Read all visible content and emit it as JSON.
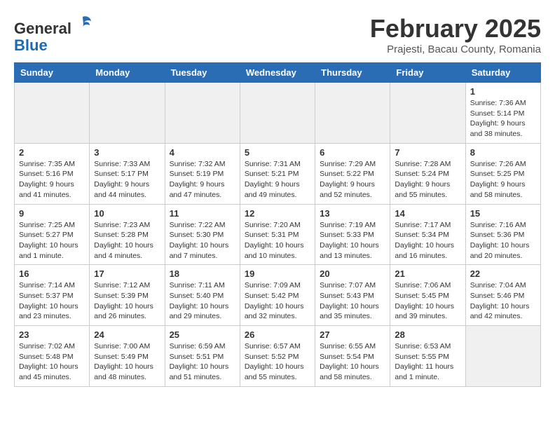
{
  "header": {
    "logo_line1": "General",
    "logo_line2": "Blue",
    "month": "February 2025",
    "location": "Prajesti, Bacau County, Romania"
  },
  "columns": [
    "Sunday",
    "Monday",
    "Tuesday",
    "Wednesday",
    "Thursday",
    "Friday",
    "Saturday"
  ],
  "weeks": [
    [
      {
        "day": "",
        "info": ""
      },
      {
        "day": "",
        "info": ""
      },
      {
        "day": "",
        "info": ""
      },
      {
        "day": "",
        "info": ""
      },
      {
        "day": "",
        "info": ""
      },
      {
        "day": "",
        "info": ""
      },
      {
        "day": "1",
        "info": "Sunrise: 7:36 AM\nSunset: 5:14 PM\nDaylight: 9 hours\nand 38 minutes."
      }
    ],
    [
      {
        "day": "2",
        "info": "Sunrise: 7:35 AM\nSunset: 5:16 PM\nDaylight: 9 hours\nand 41 minutes."
      },
      {
        "day": "3",
        "info": "Sunrise: 7:33 AM\nSunset: 5:17 PM\nDaylight: 9 hours\nand 44 minutes."
      },
      {
        "day": "4",
        "info": "Sunrise: 7:32 AM\nSunset: 5:19 PM\nDaylight: 9 hours\nand 47 minutes."
      },
      {
        "day": "5",
        "info": "Sunrise: 7:31 AM\nSunset: 5:21 PM\nDaylight: 9 hours\nand 49 minutes."
      },
      {
        "day": "6",
        "info": "Sunrise: 7:29 AM\nSunset: 5:22 PM\nDaylight: 9 hours\nand 52 minutes."
      },
      {
        "day": "7",
        "info": "Sunrise: 7:28 AM\nSunset: 5:24 PM\nDaylight: 9 hours\nand 55 minutes."
      },
      {
        "day": "8",
        "info": "Sunrise: 7:26 AM\nSunset: 5:25 PM\nDaylight: 9 hours\nand 58 minutes."
      }
    ],
    [
      {
        "day": "9",
        "info": "Sunrise: 7:25 AM\nSunset: 5:27 PM\nDaylight: 10 hours\nand 1 minute."
      },
      {
        "day": "10",
        "info": "Sunrise: 7:23 AM\nSunset: 5:28 PM\nDaylight: 10 hours\nand 4 minutes."
      },
      {
        "day": "11",
        "info": "Sunrise: 7:22 AM\nSunset: 5:30 PM\nDaylight: 10 hours\nand 7 minutes."
      },
      {
        "day": "12",
        "info": "Sunrise: 7:20 AM\nSunset: 5:31 PM\nDaylight: 10 hours\nand 10 minutes."
      },
      {
        "day": "13",
        "info": "Sunrise: 7:19 AM\nSunset: 5:33 PM\nDaylight: 10 hours\nand 13 minutes."
      },
      {
        "day": "14",
        "info": "Sunrise: 7:17 AM\nSunset: 5:34 PM\nDaylight: 10 hours\nand 16 minutes."
      },
      {
        "day": "15",
        "info": "Sunrise: 7:16 AM\nSunset: 5:36 PM\nDaylight: 10 hours\nand 20 minutes."
      }
    ],
    [
      {
        "day": "16",
        "info": "Sunrise: 7:14 AM\nSunset: 5:37 PM\nDaylight: 10 hours\nand 23 minutes."
      },
      {
        "day": "17",
        "info": "Sunrise: 7:12 AM\nSunset: 5:39 PM\nDaylight: 10 hours\nand 26 minutes."
      },
      {
        "day": "18",
        "info": "Sunrise: 7:11 AM\nSunset: 5:40 PM\nDaylight: 10 hours\nand 29 minutes."
      },
      {
        "day": "19",
        "info": "Sunrise: 7:09 AM\nSunset: 5:42 PM\nDaylight: 10 hours\nand 32 minutes."
      },
      {
        "day": "20",
        "info": "Sunrise: 7:07 AM\nSunset: 5:43 PM\nDaylight: 10 hours\nand 35 minutes."
      },
      {
        "day": "21",
        "info": "Sunrise: 7:06 AM\nSunset: 5:45 PM\nDaylight: 10 hours\nand 39 minutes."
      },
      {
        "day": "22",
        "info": "Sunrise: 7:04 AM\nSunset: 5:46 PM\nDaylight: 10 hours\nand 42 minutes."
      }
    ],
    [
      {
        "day": "23",
        "info": "Sunrise: 7:02 AM\nSunset: 5:48 PM\nDaylight: 10 hours\nand 45 minutes."
      },
      {
        "day": "24",
        "info": "Sunrise: 7:00 AM\nSunset: 5:49 PM\nDaylight: 10 hours\nand 48 minutes."
      },
      {
        "day": "25",
        "info": "Sunrise: 6:59 AM\nSunset: 5:51 PM\nDaylight: 10 hours\nand 51 minutes."
      },
      {
        "day": "26",
        "info": "Sunrise: 6:57 AM\nSunset: 5:52 PM\nDaylight: 10 hours\nand 55 minutes."
      },
      {
        "day": "27",
        "info": "Sunrise: 6:55 AM\nSunset: 5:54 PM\nDaylight: 10 hours\nand 58 minutes."
      },
      {
        "day": "28",
        "info": "Sunrise: 6:53 AM\nSunset: 5:55 PM\nDaylight: 11 hours\nand 1 minute."
      },
      {
        "day": "",
        "info": ""
      }
    ]
  ]
}
